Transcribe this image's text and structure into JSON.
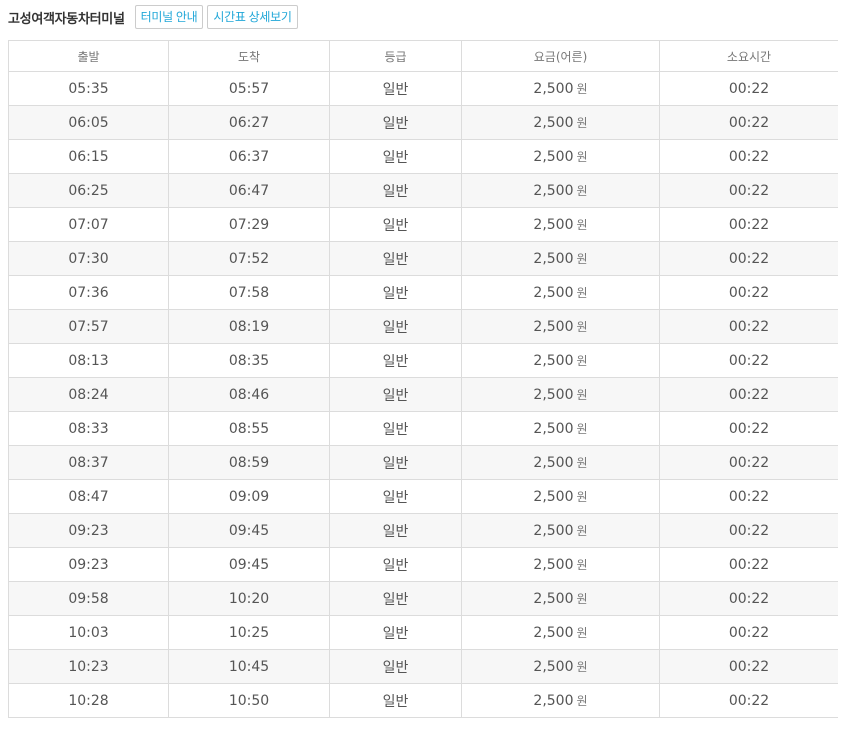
{
  "header": {
    "terminal_name": "고성여객자동차터미널",
    "info_button": "터미널 안내",
    "schedule_button": "시간표 상세보기"
  },
  "table": {
    "columns": [
      "출발",
      "도착",
      "등급",
      "요금(어른)",
      "소요시간"
    ],
    "currency_unit": "원",
    "rows": [
      {
        "depart": "05:35",
        "arrive": "05:57",
        "grade": "일반",
        "fare": "2,500",
        "duration": "00:22"
      },
      {
        "depart": "06:05",
        "arrive": "06:27",
        "grade": "일반",
        "fare": "2,500",
        "duration": "00:22"
      },
      {
        "depart": "06:15",
        "arrive": "06:37",
        "grade": "일반",
        "fare": "2,500",
        "duration": "00:22"
      },
      {
        "depart": "06:25",
        "arrive": "06:47",
        "grade": "일반",
        "fare": "2,500",
        "duration": "00:22"
      },
      {
        "depart": "07:07",
        "arrive": "07:29",
        "grade": "일반",
        "fare": "2,500",
        "duration": "00:22"
      },
      {
        "depart": "07:30",
        "arrive": "07:52",
        "grade": "일반",
        "fare": "2,500",
        "duration": "00:22"
      },
      {
        "depart": "07:36",
        "arrive": "07:58",
        "grade": "일반",
        "fare": "2,500",
        "duration": "00:22"
      },
      {
        "depart": "07:57",
        "arrive": "08:19",
        "grade": "일반",
        "fare": "2,500",
        "duration": "00:22"
      },
      {
        "depart": "08:13",
        "arrive": "08:35",
        "grade": "일반",
        "fare": "2,500",
        "duration": "00:22"
      },
      {
        "depart": "08:24",
        "arrive": "08:46",
        "grade": "일반",
        "fare": "2,500",
        "duration": "00:22"
      },
      {
        "depart": "08:33",
        "arrive": "08:55",
        "grade": "일반",
        "fare": "2,500",
        "duration": "00:22"
      },
      {
        "depart": "08:37",
        "arrive": "08:59",
        "grade": "일반",
        "fare": "2,500",
        "duration": "00:22"
      },
      {
        "depart": "08:47",
        "arrive": "09:09",
        "grade": "일반",
        "fare": "2,500",
        "duration": "00:22"
      },
      {
        "depart": "09:23",
        "arrive": "09:45",
        "grade": "일반",
        "fare": "2,500",
        "duration": "00:22"
      },
      {
        "depart": "09:23",
        "arrive": "09:45",
        "grade": "일반",
        "fare": "2,500",
        "duration": "00:22"
      },
      {
        "depart": "09:58",
        "arrive": "10:20",
        "grade": "일반",
        "fare": "2,500",
        "duration": "00:22"
      },
      {
        "depart": "10:03",
        "arrive": "10:25",
        "grade": "일반",
        "fare": "2,500",
        "duration": "00:22"
      },
      {
        "depart": "10:23",
        "arrive": "10:45",
        "grade": "일반",
        "fare": "2,500",
        "duration": "00:22"
      },
      {
        "depart": "10:28",
        "arrive": "10:50",
        "grade": "일반",
        "fare": "2,500",
        "duration": "00:22"
      }
    ]
  }
}
